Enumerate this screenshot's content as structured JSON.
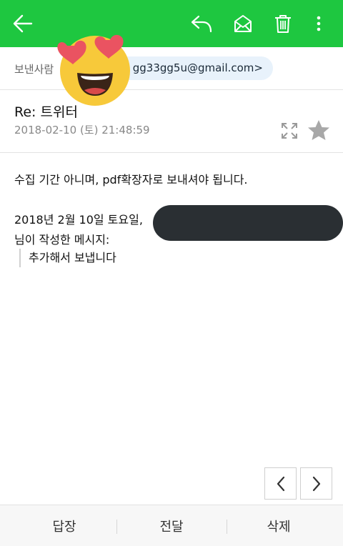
{
  "toolbar": {
    "back_icon": "arrow-left-icon",
    "reply_icon": "reply-icon",
    "mark_read_icon": "envelope-open-icon",
    "delete_icon": "trash-icon",
    "more_icon": "more-vertical-icon",
    "color": "#1ec740"
  },
  "sender": {
    "label": "보낸사람",
    "address": "gg33gg5u@gmail.com>"
  },
  "overlay": {
    "emoji": "heart-eyes-emoji"
  },
  "message": {
    "subject": "Re: 트위터",
    "date": "2018-02-10 (토) 21:48:59",
    "body_line1": "수집 기간 아니며, pdf확장자로 보내셔야 됩니다.",
    "quote_header": "2018년 2월 10일 토요일,",
    "quote_author_suffix": "님이 작성한 메시지:",
    "quoted_text": "추가해서 보냅니다"
  },
  "pager": {
    "prev_icon": "chevron-left-icon",
    "next_icon": "chevron-right-icon"
  },
  "actions": {
    "reply": "답장",
    "forward": "전달",
    "delete": "삭제"
  }
}
